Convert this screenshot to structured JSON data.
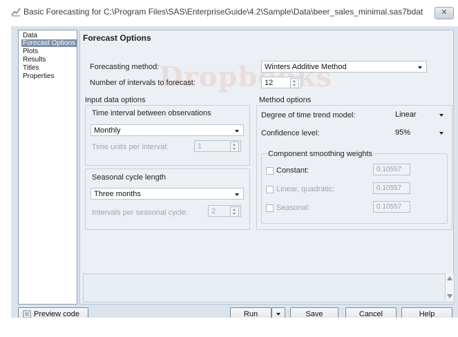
{
  "window": {
    "title": "Basic Forecasting for C:\\Program Files\\SAS\\EnterpriseGuide\\4.2\\Sample\\Data\\beer_sales_minimal.sas7bdat",
    "close_label": "✕"
  },
  "watermark": "Dropbooks",
  "nav": {
    "items": [
      "Data",
      "Forecast Options",
      "Plots",
      "Results",
      "Titles",
      "Properties"
    ],
    "selected": "Forecast Options"
  },
  "page": {
    "heading": "Forecast Options"
  },
  "forecast": {
    "method_label": "Forecasting method:",
    "method_value": "Winters Additive Method",
    "intervals_label": "Number of intervals to forecast:",
    "intervals_value": "12"
  },
  "input_options": {
    "group_label": "Input data options",
    "time_interval_label": "Time interval between observations",
    "time_interval_value": "Monthly",
    "time_units_label": "Time units per interval:",
    "time_units_value": "1",
    "seasonal_label": "Seasonal cycle length",
    "seasonal_value": "Three months",
    "intervals_per_cycle_label": "Intervals per seasonal cycle:",
    "intervals_per_cycle_value": "2"
  },
  "method_options": {
    "group_label": "Method options",
    "trend_label": "Degree of time trend model:",
    "trend_value": "Linear",
    "confidence_label": "Confidence level:",
    "confidence_value": "95%",
    "smoothing_group_label": "Component smoothing weights",
    "weights": [
      {
        "label": "Constant:",
        "value": "0.10557",
        "checked": false,
        "enabled": true
      },
      {
        "label": "Linear, quadratic:",
        "value": "0.10557",
        "checked": false,
        "enabled": false
      },
      {
        "label": "Seasonal:",
        "value": "0.10557",
        "checked": false,
        "enabled": false
      }
    ]
  },
  "buttons": {
    "preview": "Preview code",
    "run": "Run",
    "save": "Save",
    "cancel": "Cancel",
    "help": "Help"
  }
}
